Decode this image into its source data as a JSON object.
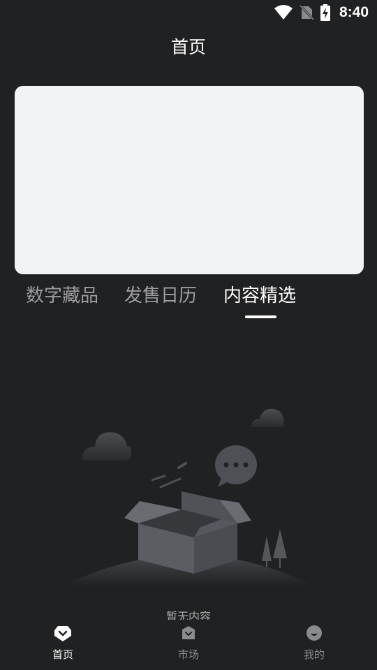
{
  "status_bar": {
    "time": "8:40",
    "icons": [
      "wifi-icon",
      "no-sim-icon",
      "battery-charging-icon"
    ]
  },
  "header": {
    "title": "首页"
  },
  "tabs": [
    {
      "label": "数字藏品",
      "active": false
    },
    {
      "label": "发售日历",
      "active": false
    },
    {
      "label": "内容精选",
      "active": true
    }
  ],
  "empty_state": {
    "text": "暂无内容"
  },
  "bottom_nav": [
    {
      "label": "首页",
      "icon": "home-icon",
      "active": true
    },
    {
      "label": "市场",
      "icon": "market-icon",
      "active": false
    },
    {
      "label": "我的",
      "icon": "profile-icon",
      "active": false
    }
  ],
  "colors": {
    "background": "#202122",
    "banner": "#f2f3f4",
    "tab_inactive": "#9d9d9f",
    "tab_active": "#ffffff",
    "nav_inactive": "#8a8b8d"
  }
}
